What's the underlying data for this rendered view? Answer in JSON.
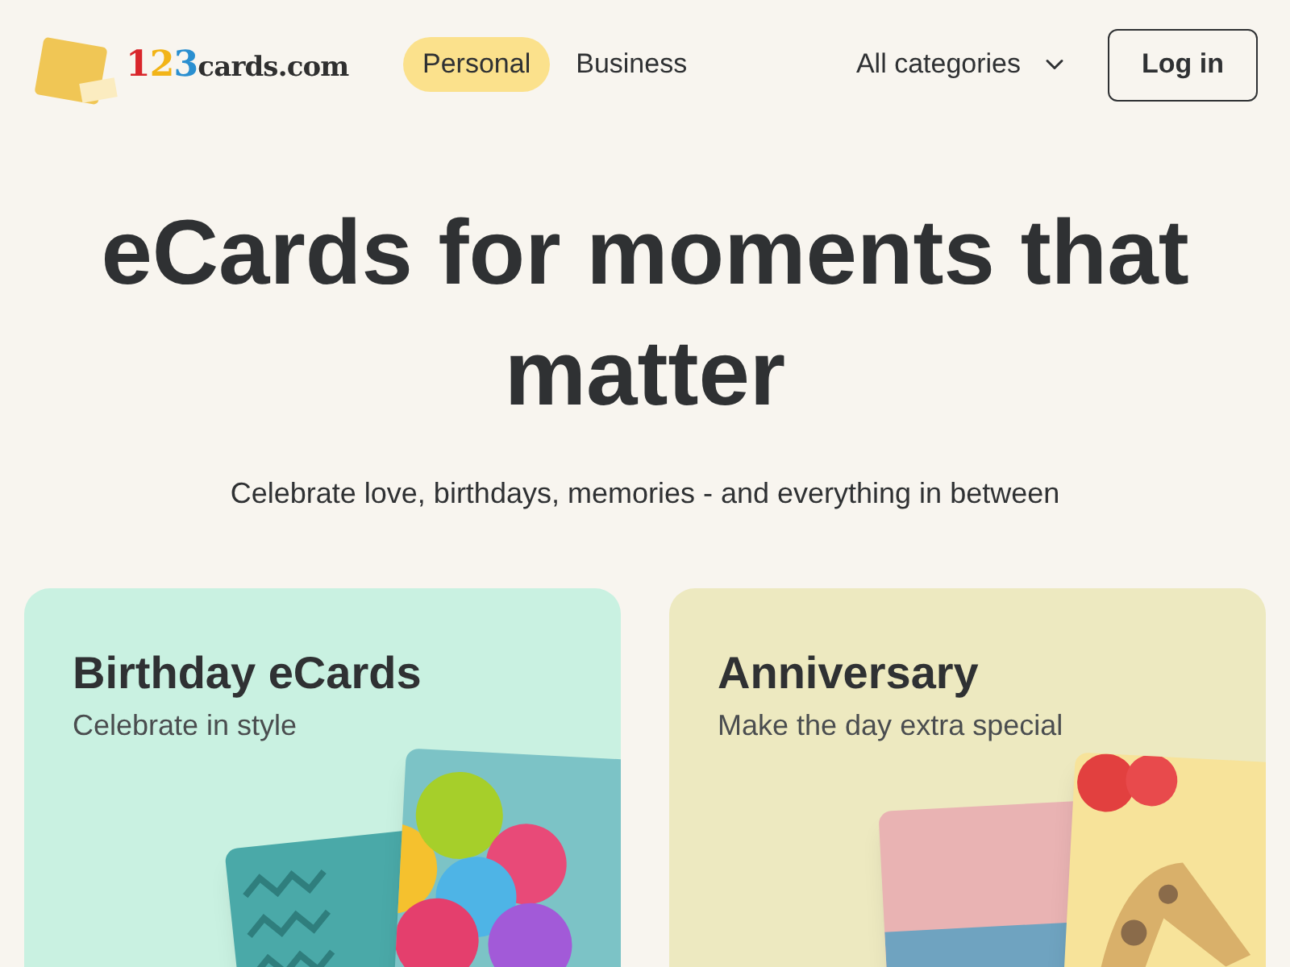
{
  "header": {
    "logo": [
      {
        "text": "1",
        "color": "#d9262b"
      },
      {
        "text": "2",
        "color": "#f2b418"
      },
      {
        "text": "3",
        "color": "#2a8fd0"
      },
      {
        "text": "cards.com",
        "color": "#2f2f2f"
      }
    ],
    "nav": [
      {
        "label": "Personal",
        "selected": true
      },
      {
        "label": "Business",
        "selected": false
      }
    ],
    "categories": {
      "label": "All categories",
      "expanded": false
    },
    "login": "Log in"
  },
  "hero": {
    "title": "eCards for moments that matter",
    "subtitle": "Celebrate love, birthdays, memories - and everything in between"
  },
  "cards": [
    {
      "title": "Birthday eCards",
      "subtitle": "Celebrate in style",
      "kind": "birthday",
      "color": "#c9f1e1"
    },
    {
      "title": "Anniversary",
      "subtitle": "Make the day extra special",
      "kind": "anniversary",
      "color": "#ede9c0"
    }
  ]
}
